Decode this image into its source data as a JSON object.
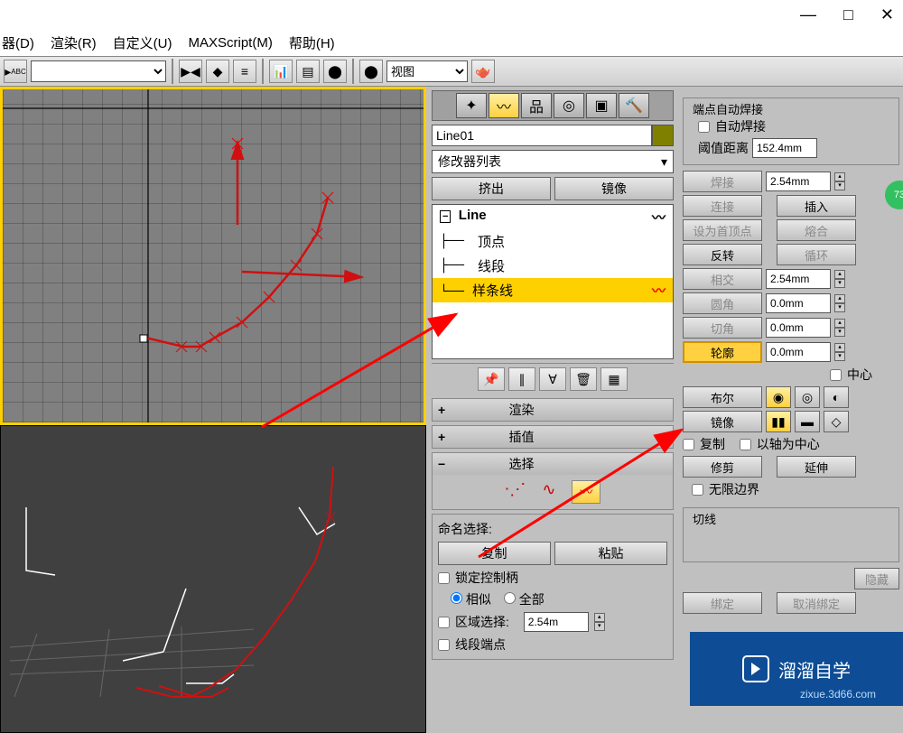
{
  "window": {
    "minimize": "—",
    "maximize": "□",
    "close": "✕"
  },
  "menu": [
    "器(D)",
    "渲染(R)",
    "自定义(U)",
    "MAXScript(M)",
    "帮助(H)"
  ],
  "toolbar": {
    "view_select": "视图"
  },
  "center": {
    "obj_name": "Line01",
    "mod_list": "修改器列表",
    "extrude": "挤出",
    "mirror": "镜像",
    "stack_root": "Line",
    "stack": [
      "顶点",
      "线段",
      "样条线"
    ],
    "render": "渲染",
    "interp": "插值",
    "select": "选择",
    "naming": "命名选择:",
    "copy": "复制",
    "paste": "粘贴",
    "lock_handles": "锁定控制柄",
    "similar": "相似",
    "all": "全部",
    "area_sel": "区域选择:",
    "area_val": "2.54m",
    "seg_end": "线段端点"
  },
  "right": {
    "auto_weld_group": "端点自动焊接",
    "auto_weld": "自动焊接",
    "threshold": "阈值距离",
    "threshold_val": "152.4mm",
    "weld": "焊接",
    "weld_val": "2.54mm",
    "connect": "连接",
    "insert": "插入",
    "first_vert": "设为首顶点",
    "fuse": "熔合",
    "reverse": "反转",
    "cycle": "循环",
    "cross": "相交",
    "cross_val": "2.54mm",
    "fillet": "圆角",
    "fillet_val": "0.0mm",
    "chamfer": "切角",
    "chamfer_val": "0.0mm",
    "outline": "轮廓",
    "outline_val": "0.0mm",
    "center": "中心",
    "boolean": "布尔",
    "mirror_r": "镜像",
    "copy": "复制",
    "axis_center": "以轴为中心",
    "trim": "修剪",
    "extend": "延伸",
    "inf_bounds": "无限边界",
    "tangent": "切线",
    "bind": "绑定",
    "unbind": "取消绑定"
  },
  "badge": "73",
  "watermark": {
    "text": "溜溜自学",
    "url": "zixue.3d66.com"
  },
  "hidden_btn": "隐藏"
}
